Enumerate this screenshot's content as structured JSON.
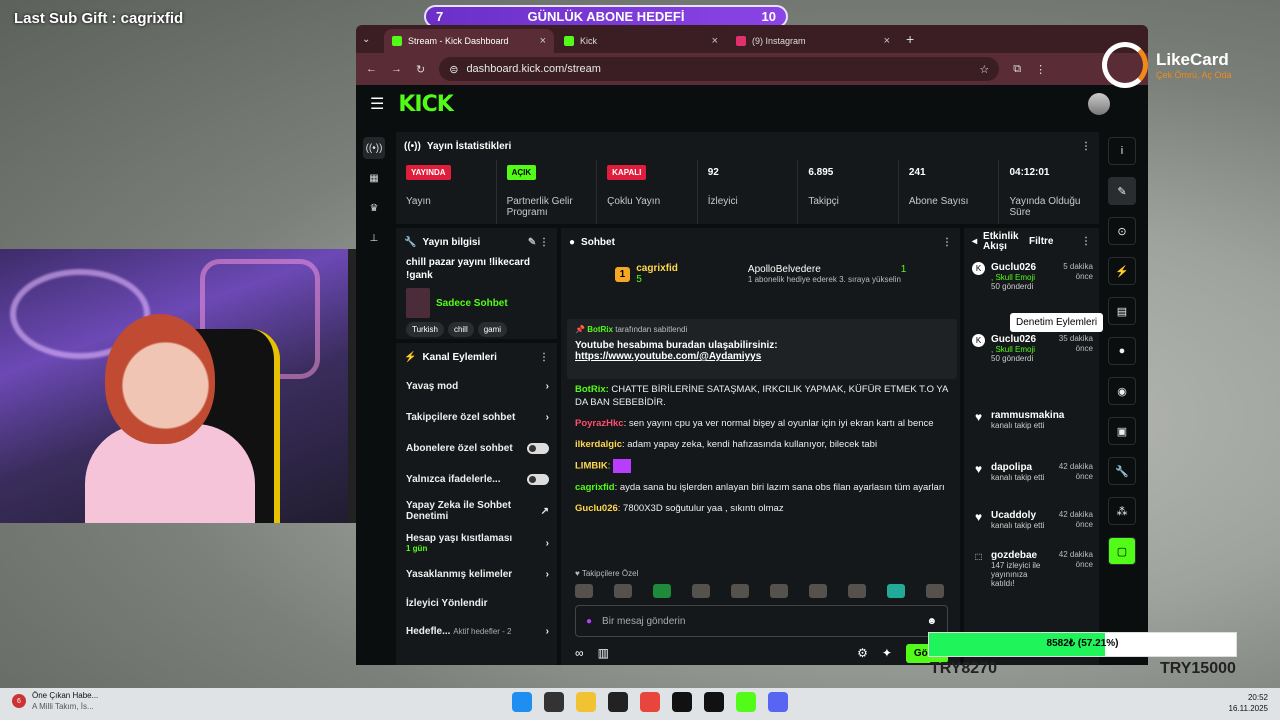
{
  "overlay": {
    "last_sub": "Last Sub Gift : cagrixfid"
  },
  "goal": {
    "left": "7",
    "title": "GÜNLÜK ABONE HEDEFİ",
    "right": "10"
  },
  "browser": {
    "tabs": [
      {
        "label": "Stream - Kick Dashboard"
      },
      {
        "label": "Kick"
      },
      {
        "label": "(9) Instagram"
      }
    ],
    "url": "dashboard.kick.com/stream"
  },
  "stats": {
    "title": "Yayın İstatistikleri",
    "items": [
      {
        "value": "YAYINDA",
        "label": "Yayın"
      },
      {
        "value": "AÇIK",
        "label": "Partnerlik Gelir Programı"
      },
      {
        "value": "KAPALI",
        "label": "Çoklu Yayın"
      },
      {
        "value": "92",
        "label": "İzleyici"
      },
      {
        "value": "6.895",
        "label": "Takipçi"
      },
      {
        "value": "241",
        "label": "Abone Sayısı"
      },
      {
        "value": "04:12:01",
        "label": "Yayında Olduğu Süre"
      }
    ]
  },
  "info": {
    "title": "Yayın bilgisi",
    "stream_title": "chill pazar yayını !likecard !gank",
    "category": "Sadece Sohbet",
    "tags": [
      "Turkish",
      "chill",
      "gami"
    ]
  },
  "actions": {
    "title": "Kanal Eylemleri",
    "items": [
      {
        "label": "Yavaş mod",
        "sub": ""
      },
      {
        "label": "Takipçilere özel sohbet",
        "sub": ""
      },
      {
        "label": "Abonelere özel sohbet",
        "sub": ""
      },
      {
        "label": "Yalnızca ifadelerle...",
        "sub": ""
      },
      {
        "label": "Yapay Zeka ile Sohbet Denetimi",
        "sub": ""
      },
      {
        "label": "Hesap yaşı kısıtlaması",
        "sub": "1 gün"
      },
      {
        "label": "Yasaklanmış kelimeler",
        "sub": ""
      },
      {
        "label": "İzleyici Yönlendir",
        "sub": ""
      },
      {
        "label": "Hedefle...",
        "sub": "Aktif hedefler - 2"
      }
    ]
  },
  "chat": {
    "title": "Sohbet",
    "leader": {
      "rank": "1",
      "name": "cagrixfid",
      "count": "5",
      "gifter": "ApolloBelvedere",
      "gifter_count": "1",
      "gift_text": "1 abonelik hediye ederek 3. sıraya yükselin"
    },
    "pinned": {
      "user": "BotRix",
      "by": "tarafından sabitlendi",
      "text": "Youtube hesabıma buradan ulaşabilirsiniz:",
      "link": "https://www.youtube.com/@Aydamiyys"
    },
    "messages": [
      {
        "user": "BotRix:",
        "text": "CHATTE BİRİLERİNE SATAŞMAK, IRKCILIK YAPMAK, KÜFÜR ETMEK T.O YA DA BAN SEBEBİDİR."
      },
      {
        "user": "PoyrazHkc",
        "text": ": sen yayını cpu ya ver normal bişey al oyunlar için iyi ekran kartı al bence"
      },
      {
        "user": "ilkerdalgic",
        "text": ": adam yapay zeka, kendi hafızasında kullanıyor, bilecek tabi"
      },
      {
        "user": "LIMBIK",
        "text": ":"
      },
      {
        "user": "cagrixfid",
        "text": ": ayda sana bu işlerden anlayan biri lazım sana obs filan ayarlasın tüm ayarları"
      },
      {
        "user": "Guclu026",
        "text": ": 7800X3D soğutulur yaa , sıkıntı olmaz"
      }
    ],
    "emote_label": "Takipçilere Özel",
    "placeholder": "Bir mesaj gönderin",
    "send": "Gönd"
  },
  "feed": {
    "title": "Etkinlik Akışı",
    "filter": "Filtre",
    "events": [
      {
        "name": "Guclu026",
        "time": "5 dakika önce",
        "line1": ", Skull Emoji",
        "line2": "50 gönderdi"
      },
      {
        "name": "Guclu026",
        "time": "35 dakika önce",
        "line1": ", Skull Emoji",
        "line2": "50 gönderdi"
      },
      {
        "name": "rammusmakina",
        "time": "",
        "line1": "kanalı takip etti",
        "line2": ""
      },
      {
        "name": "dapolipa",
        "time": "42 dakika önce",
        "line1": "kanalı takip etti",
        "line2": ""
      },
      {
        "name": "Ucaddoly",
        "time": "42 dakika önce",
        "line1": "kanalı takip etti",
        "line2": ""
      },
      {
        "name": "gozdebae",
        "time": "42 dakika önce",
        "line1": "147 izleyici ile yayınınıza katıldı!",
        "line2": ""
      }
    ]
  },
  "tooltip": "Denetim Eylemleri",
  "likecard": {
    "name": "LikeCard",
    "tagline": "Çek Ömrü, Aç Oda"
  },
  "donation": {
    "text": "8582₺ (57.21%)",
    "percent": 57.21,
    "left": "TRY8270",
    "right": "TRY15000"
  },
  "taskbar": {
    "news_title": "Öne Çıkan Habe...",
    "news_sub": "A Milli Takım, İs...",
    "badge": "6",
    "time": "20:52",
    "date": "16.11.2025"
  }
}
